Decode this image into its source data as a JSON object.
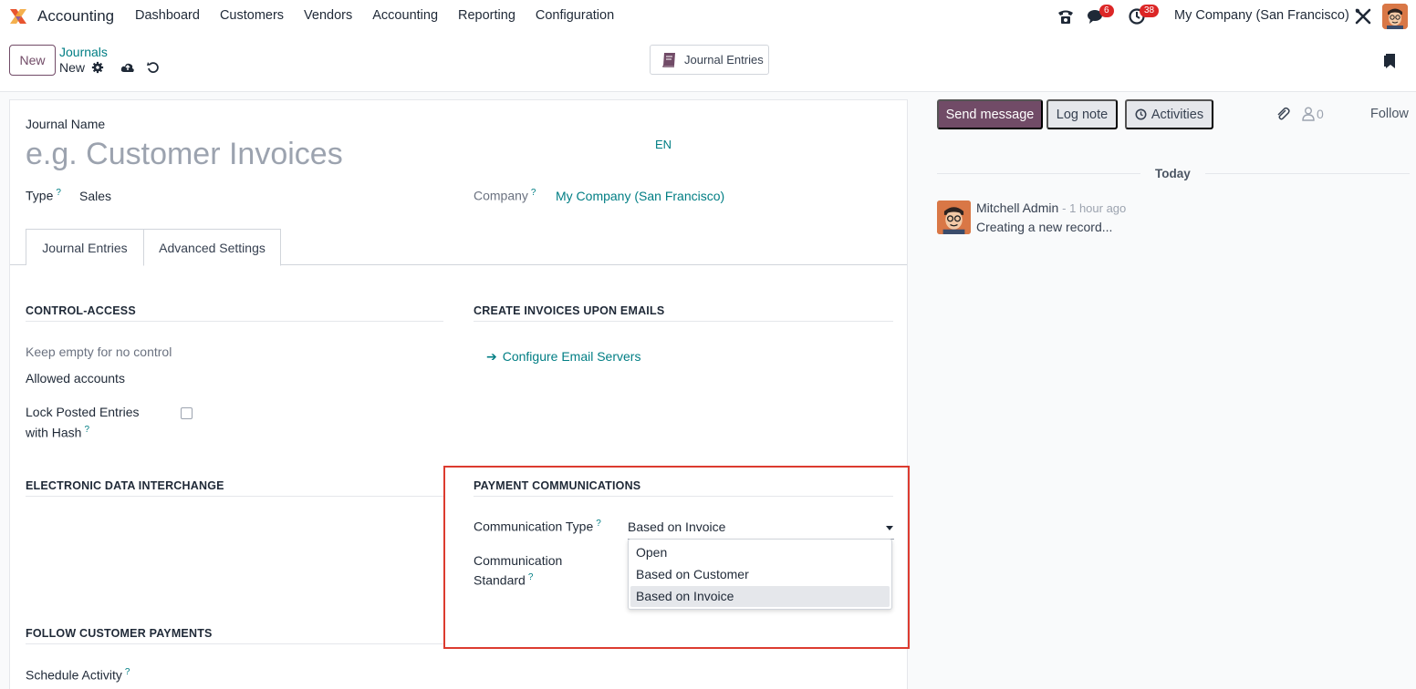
{
  "navbar": {
    "app_name": "Accounting",
    "menu": [
      "Dashboard",
      "Customers",
      "Vendors",
      "Accounting",
      "Reporting",
      "Configuration"
    ],
    "messages_badge": "6",
    "activities_badge": "38",
    "company": "My Company (San Francisco)"
  },
  "control_panel": {
    "new_label": "New",
    "breadcrumb_parent": "Journals",
    "breadcrumb_current": "New",
    "smart_button": "Journal Entries"
  },
  "form": {
    "journal_name_label": "Journal Name",
    "journal_name_placeholder": "e.g. Customer Invoices",
    "lang": "EN",
    "type_label": "Type",
    "type_value": "Sales",
    "company_label": "Company",
    "company_value": "My Company (San Francisco)",
    "help_mark": "?",
    "tabs": [
      "Journal Entries",
      "Advanced Settings"
    ],
    "control_access": {
      "title": "CONTROL-ACCESS",
      "hint": "Keep empty for no control",
      "allowed_accounts": "Allowed accounts",
      "lock_line1": "Lock Posted Entries",
      "lock_line2": "with Hash"
    },
    "create_invoices": {
      "title": "CREATE INVOICES UPON EMAILS",
      "link": "Configure Email Servers"
    },
    "edi": {
      "title": "ELECTRONIC DATA INTERCHANGE"
    },
    "payment_comm": {
      "title": "PAYMENT COMMUNICATIONS",
      "type_label": "Communication Type",
      "type_value": "Based on Invoice",
      "standard_line1": "Communication",
      "standard_line2": "Standard",
      "options": [
        "Open",
        "Based on Customer",
        "Based on Invoice"
      ]
    },
    "follow_payments": {
      "title": "FOLLOW CUSTOMER PAYMENTS",
      "schedule_activity": "Schedule Activity"
    }
  },
  "chatter": {
    "send_message": "Send message",
    "log_note": "Log note",
    "activities": "Activities",
    "followers_count": "0",
    "follow": "Follow",
    "today": "Today",
    "message": {
      "author": "Mitchell Admin",
      "time": "- 1 hour ago",
      "body": "Creating a new record..."
    }
  },
  "colors": {
    "brand": "#714b67",
    "link": "#017e84",
    "badge": "#dc2626",
    "highlight": "#dc3b2f"
  }
}
